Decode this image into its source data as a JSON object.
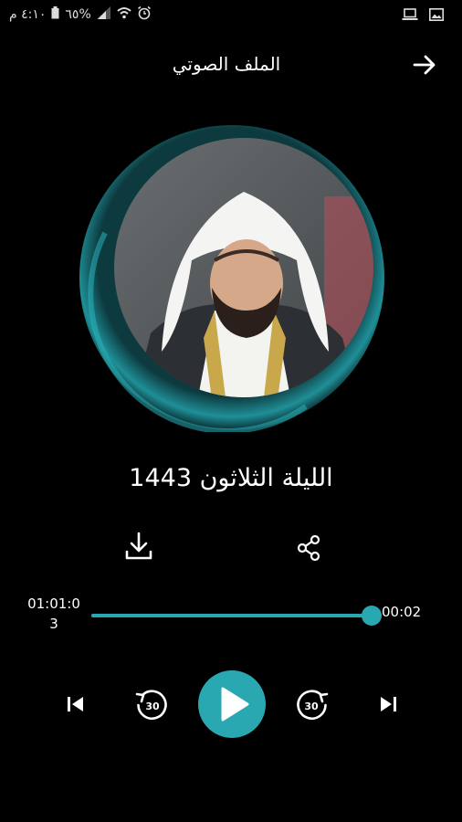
{
  "status_bar": {
    "time": "٤:١٠ م",
    "battery": "٦٥%",
    "icons": [
      "battery-icon",
      "signal-icon",
      "wifi-icon",
      "alarm-icon",
      "laptop-icon",
      "image-icon"
    ]
  },
  "header": {
    "title": "الملف الصوتي",
    "back_icon": "arrow-right-icon"
  },
  "cover": {
    "image": "reciter-portrait",
    "ring_color": "#1f8f97"
  },
  "track": {
    "title": "الليلة الثلاثون 1443"
  },
  "actions": {
    "download_icon": "download-icon",
    "share_icon": "share-icon"
  },
  "player": {
    "total_time_line1": "01:01:0",
    "total_time_line2": "3",
    "current_time": "00:02",
    "progress": 0.99,
    "accent": "#2aa8b1",
    "skip_back_seconds": "30",
    "skip_forward_seconds": "30"
  }
}
